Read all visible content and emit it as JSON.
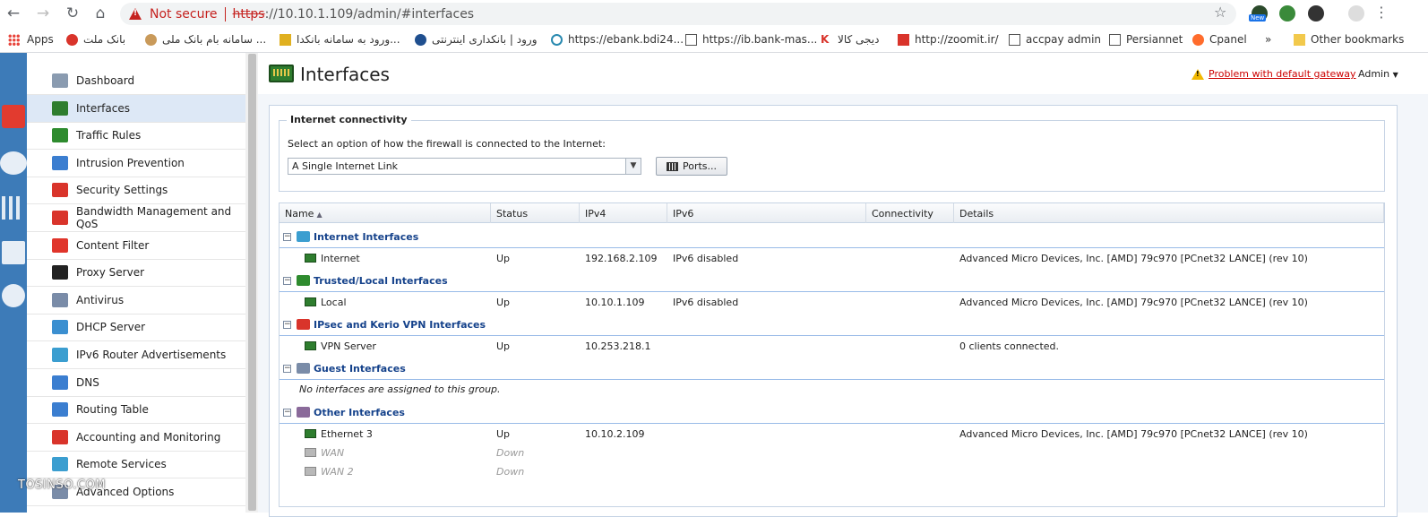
{
  "browser": {
    "not_secure": "Not secure",
    "url_scheme": "https",
    "url_rest": "://10.10.1.109/admin/#interfaces",
    "ext_badge": "New",
    "bookmarks": [
      {
        "label": "Apps",
        "icon": "apps-icon"
      },
      {
        "label": "بانک ملت",
        "icon": "bank-mellat-icon"
      },
      {
        "label": "سامانه بام بانک ملی ...",
        "icon": "bank-melli-icon"
      },
      {
        "label": "ورود به سامانه بانکدا...",
        "icon": "bank-icon"
      },
      {
        "label": "ورود | بانکداری اینترنتی",
        "icon": "bank-icon"
      },
      {
        "label": "https://ebank.bdi24...",
        "icon": "link-icon"
      },
      {
        "label": "https://ib.bank-mas...",
        "icon": "page-icon"
      },
      {
        "label": "دیجی کالا",
        "icon": "digikala-icon"
      },
      {
        "label": "http://zoomit.ir/",
        "icon": "zoomit-icon"
      },
      {
        "label": "accpay admin",
        "icon": "page-icon"
      },
      {
        "label": "Persiannet",
        "icon": "page-icon"
      },
      {
        "label": "Cpanel",
        "icon": "cpanel-icon"
      },
      {
        "label": "»",
        "icon": "more-icon"
      },
      {
        "label": "Other bookmarks",
        "icon": "folder-icon"
      }
    ]
  },
  "sidebar": {
    "items": [
      {
        "label": "Dashboard",
        "icon": "dashboard-icon",
        "color": "#8a9bb0"
      },
      {
        "label": "Interfaces",
        "icon": "network-card-icon",
        "color": "#2e7d2e"
      },
      {
        "label": "Traffic Rules",
        "icon": "traffic-light-icon",
        "color": "#2e8b2e"
      },
      {
        "label": "Intrusion Prevention",
        "icon": "shield-icon",
        "color": "#3b7ed0"
      },
      {
        "label": "Security Settings",
        "icon": "hand-stop-icon",
        "color": "#d9342b"
      },
      {
        "label": "Bandwidth Management and QoS",
        "icon": "bandwidth-icon",
        "color": "#d9342b"
      },
      {
        "label": "Content Filter",
        "icon": "filter-icon",
        "color": "#e0352b"
      },
      {
        "label": "Proxy Server",
        "icon": "proxy-icon",
        "color": "#222222"
      },
      {
        "label": "Antivirus",
        "icon": "syringe-icon",
        "color": "#7a8ca8"
      },
      {
        "label": "DHCP Server",
        "icon": "dhcp-icon",
        "color": "#3b8fd0"
      },
      {
        "label": "IPv6 Router Advertisements",
        "icon": "ipv6-icon",
        "color": "#3b9ed0"
      },
      {
        "label": "DNS",
        "icon": "dns-icon",
        "color": "#3b7ed0"
      },
      {
        "label": "Routing Table",
        "icon": "routing-icon",
        "color": "#3b7ed0"
      },
      {
        "label": "Accounting and Monitoring",
        "icon": "monitoring-icon",
        "color": "#d9342b"
      },
      {
        "label": "Remote Services",
        "icon": "cloud-icon",
        "color": "#3b9ed0"
      },
      {
        "label": "Advanced Options",
        "icon": "gear-icon",
        "color": "#7a8ca8"
      }
    ]
  },
  "header": {
    "title": "Interfaces",
    "gateway_warning": "Problem with default gateway",
    "admin_menu": "Admin"
  },
  "connectivity": {
    "legend": "Internet connectivity",
    "prompt": "Select an option of how the firewall is connected to the Internet:",
    "selected_option": "A Single Internet Link",
    "ports_button": "Ports..."
  },
  "grid": {
    "columns": [
      "Name",
      "Status",
      "IPv4",
      "IPv6",
      "Connectivity",
      "Details"
    ],
    "groups": [
      {
        "label": "Internet Interfaces",
        "icon": "cloud-icon",
        "rows": [
          {
            "name": "Internet",
            "status": "Up",
            "ipv4": "192.168.2.109",
            "ipv6": "IPv6 disabled",
            "connectivity": "",
            "details": "Advanced Micro Devices, Inc. [AMD] 79c970 [PCnet32 LANCE] (rev 10)"
          }
        ]
      },
      {
        "label": "Trusted/Local Interfaces",
        "icon": "local-network-icon",
        "rows": [
          {
            "name": "Local",
            "status": "Up",
            "ipv4": "10.10.1.109",
            "ipv6": "IPv6 disabled",
            "connectivity": "",
            "details": "Advanced Micro Devices, Inc. [AMD] 79c970 [PCnet32 LANCE] (rev 10)"
          }
        ]
      },
      {
        "label": "IPsec and Kerio VPN Interfaces",
        "icon": "vpn-shield-icon",
        "rows": [
          {
            "name": "VPN Server",
            "status": "Up",
            "ipv4": "10.253.218.1",
            "ipv6": "",
            "connectivity": "",
            "details": "0 clients connected."
          }
        ]
      },
      {
        "label": "Guest Interfaces",
        "icon": "guest-user-icon",
        "empty": "No interfaces are assigned to this group.",
        "rows": []
      },
      {
        "label": "Other Interfaces",
        "icon": "other-interfaces-icon",
        "rows": [
          {
            "name": "Ethernet 3",
            "status": "Up",
            "ipv4": "10.10.2.109",
            "ipv6": "",
            "connectivity": "",
            "details": "Advanced Micro Devices, Inc. [AMD] 79c970 [PCnet32 LANCE] (rev 10)"
          },
          {
            "name": "WAN",
            "status": "Down",
            "ipv4": "",
            "ipv6": "",
            "connectivity": "",
            "details": ""
          },
          {
            "name": "WAN 2",
            "status": "Down",
            "ipv4": "",
            "ipv6": "",
            "connectivity": "",
            "details": ""
          }
        ]
      }
    ]
  },
  "watermark": "TOSINSO.COM"
}
